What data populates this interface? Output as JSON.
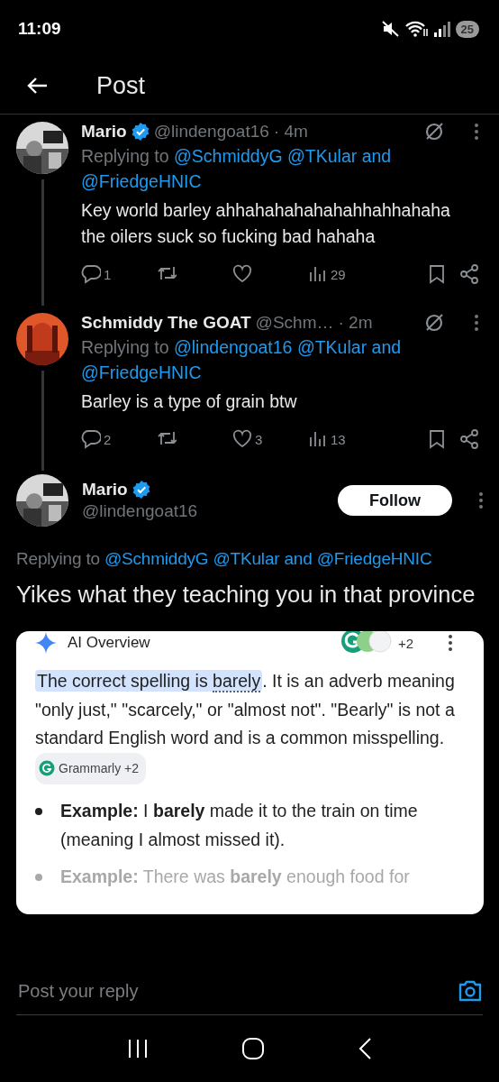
{
  "status_bar": {
    "time": "11:09",
    "battery": "25"
  },
  "header": {
    "title": "Post"
  },
  "replies": [
    {
      "name": "Mario",
      "verified": true,
      "handle": "@lindengoat16",
      "time": "· 4m",
      "replying_label": "Replying to",
      "mentions": [
        "@SchmiddyG",
        "@TKular"
      ],
      "joiner": "and",
      "last_mention": "@FriedgeHNIC",
      "text": "Key world barley ahhahahahahahahhahhahaha the oilers suck so fucking bad hahaha",
      "stats": {
        "replies": "1",
        "views": "29"
      }
    },
    {
      "name": "Schmiddy The GOAT",
      "verified": false,
      "handle": "@Schm…",
      "time": "· 2m",
      "replying_label": "Replying to",
      "mentions": [
        "@lindengoat16",
        "@TKular"
      ],
      "joiner": "and",
      "last_mention": "@FriedgeHNIC",
      "text": "Barley is a type of grain btw",
      "stats": {
        "replies": "2",
        "likes": "3",
        "views": "13"
      }
    }
  ],
  "main_post": {
    "name": "Mario",
    "verified": true,
    "handle": "@lindengoat16",
    "follow_label": "Follow",
    "replying_label": "Replying to",
    "mentions": [
      "@SchmiddyG",
      "@TKular"
    ],
    "joiner": "and",
    "last_mention": "@FriedgeHNIC",
    "text": "Yikes what they teaching you in that province",
    "attachment": {
      "title": "AI Overview",
      "sources_more": "+2",
      "highlight_lead": "The correct spelling is ",
      "highlight_term": "barely",
      "summary_rest": ". It is an adverb meaning \"only just,\" \"scarcely,\" or \"almost not\". \"Bearly\" is not a standard English word and is a common misspelling.",
      "chip": "Grammarly +2",
      "bullets": [
        {
          "text": "**Example:** I **barely** made it to the train on time (meaning I almost missed it).",
          "faded": false
        },
        {
          "text": "**Example:** There was **barely** enough food for",
          "faded": true
        }
      ]
    }
  },
  "composer": {
    "placeholder": "Post your reply"
  }
}
